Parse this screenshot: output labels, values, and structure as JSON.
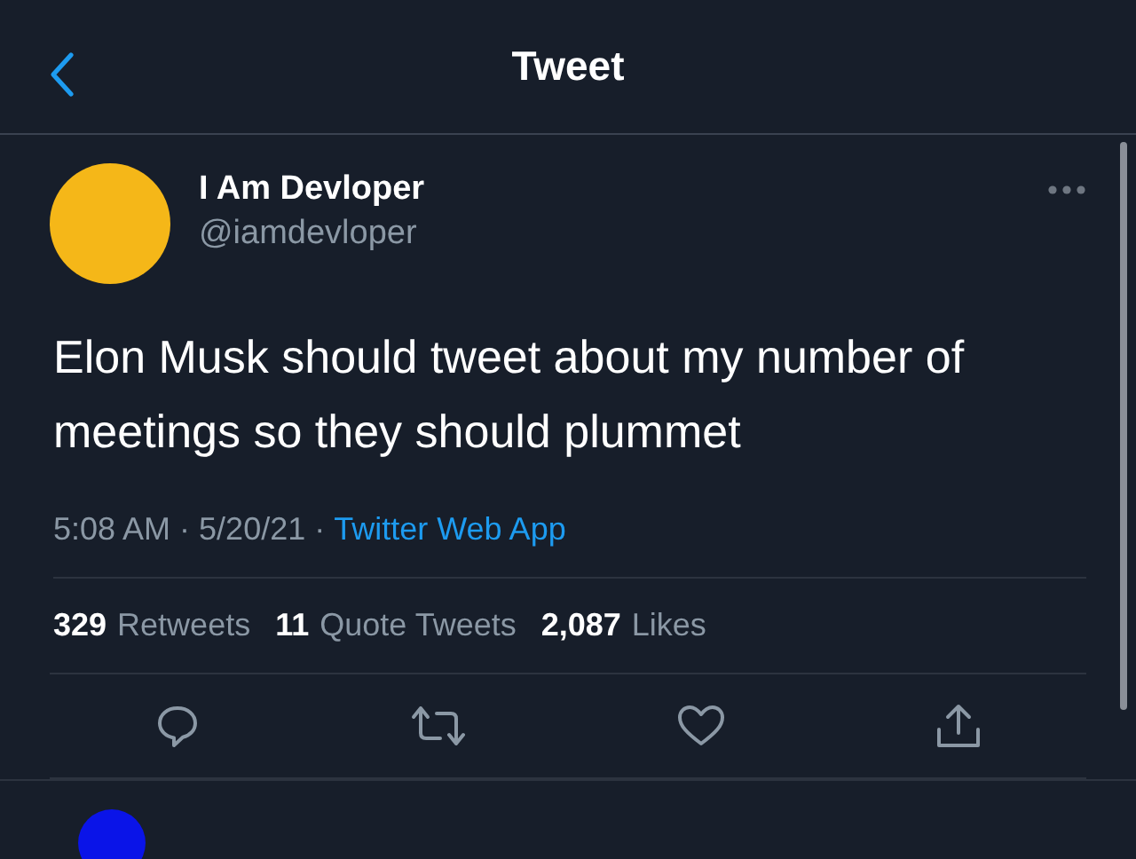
{
  "header": {
    "title": "Tweet"
  },
  "tweet": {
    "author": {
      "name": "I Am Devloper",
      "handle": "@iamdevloper"
    },
    "text": "Elon Musk should tweet about my number of meetings so they should plummet",
    "time": "5:08 AM",
    "date": "5/20/21",
    "separators": [
      "·",
      "·"
    ],
    "source": "Twitter Web App",
    "stats": [
      {
        "count": "329",
        "label": "Retweets"
      },
      {
        "count": "11",
        "label": "Quote Tweets"
      },
      {
        "count": "2,087",
        "label": "Likes"
      }
    ],
    "actions": [
      {
        "kind": "reply"
      },
      {
        "kind": "retweet"
      },
      {
        "kind": "like"
      },
      {
        "kind": "share"
      }
    ]
  }
}
